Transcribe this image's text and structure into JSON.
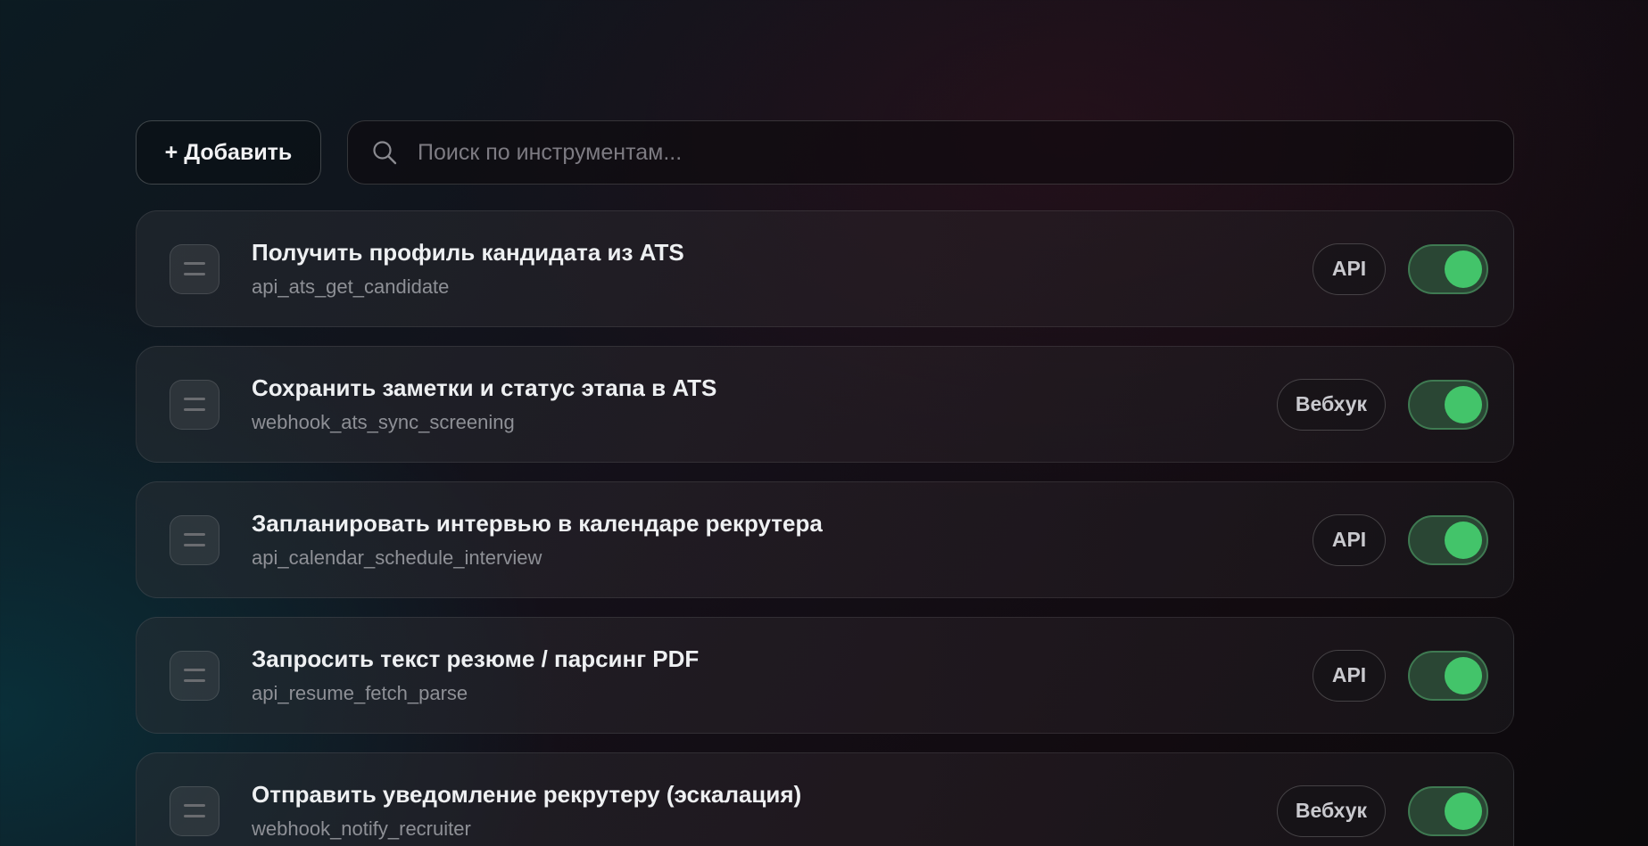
{
  "toolbar": {
    "add_label": "+ Добавить",
    "search_placeholder": "Поиск по инструментам...",
    "search_value": ""
  },
  "tools": [
    {
      "title": "Получить профиль кандидата из ATS",
      "id": "api_ats_get_candidate",
      "type": "API",
      "enabled": true
    },
    {
      "title": "Сохранить заметки и статус этапа в ATS",
      "id": "webhook_ats_sync_screening",
      "type": "Вебхук",
      "enabled": true
    },
    {
      "title": "Запланировать интервью в календаре рекрутера",
      "id": "api_calendar_schedule_interview",
      "type": "API",
      "enabled": true
    },
    {
      "title": "Запросить текст резюме / парсинг PDF",
      "id": "api_resume_fetch_parse",
      "type": "API",
      "enabled": true
    },
    {
      "title": "Отправить уведомление рекрутеру (эскалация)",
      "id": "webhook_notify_recruiter",
      "type": "Вебхук",
      "enabled": true
    }
  ],
  "colors": {
    "toggle_on": "#43c46a",
    "toggle_track": "#2a4634"
  },
  "icons": {
    "search": "search-icon",
    "drag": "drag-handle-icon"
  }
}
